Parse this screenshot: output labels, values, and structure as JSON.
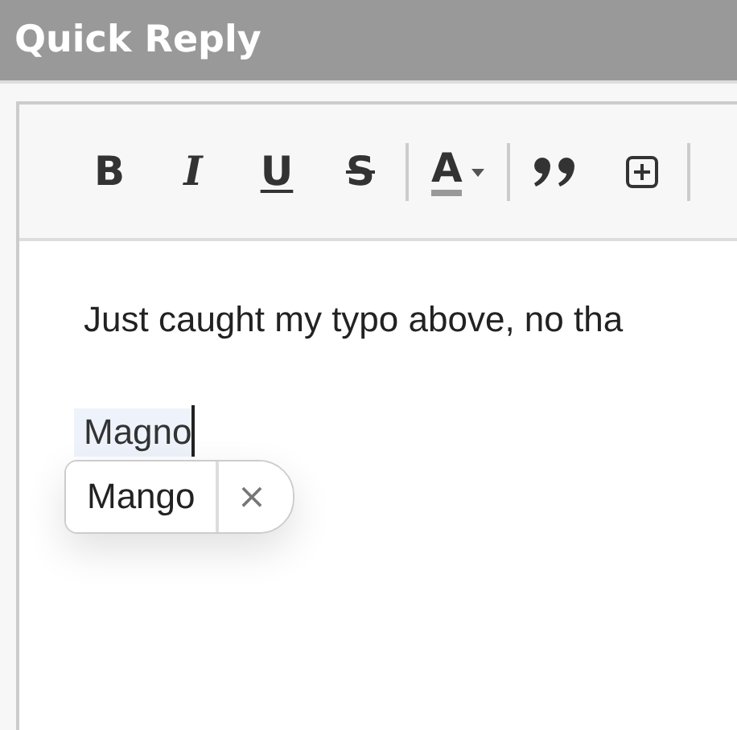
{
  "window": {
    "title": "Quick Reply"
  },
  "toolbar": [
    {
      "label": "B",
      "kind": "bold"
    },
    {
      "label": "I",
      "kind": "italic"
    },
    {
      "label": "U",
      "kind": "underline"
    },
    {
      "label": "S",
      "kind": "strike"
    },
    {
      "kind": "separator"
    },
    {
      "label": "A",
      "kind": "color"
    },
    {
      "kind": "separator"
    },
    {
      "kind": "quote"
    },
    {
      "kind": "insert"
    },
    {
      "kind": "separator"
    }
  ],
  "editor": {
    "text": "Just caught my typo above, no tha",
    "word": "Magno"
  },
  "suggestion": {
    "label": "Mango",
    "dismiss": "×"
  }
}
